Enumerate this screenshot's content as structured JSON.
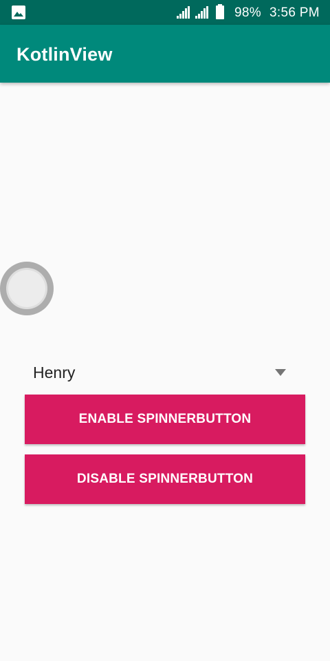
{
  "status_bar": {
    "left_icon": "gallery-icon",
    "signal_icons": [
      "signal-icon",
      "signal-icon"
    ],
    "battery_icon": "battery-icon",
    "battery_level": "98%",
    "time": "3:56 PM"
  },
  "app_bar": {
    "title": "KotlinView",
    "color": "#00897b",
    "status_color": "#00695c"
  },
  "spinner": {
    "selected": "Henry",
    "icon": "dropdown-arrow-icon"
  },
  "buttons": {
    "enable_label": "ENABLE SPINNERBUTTON",
    "disable_label": "DISABLE SPINNERBUTTON",
    "color": "#d81b60"
  },
  "toggle": {
    "icon": "switch-thumb-icon"
  }
}
